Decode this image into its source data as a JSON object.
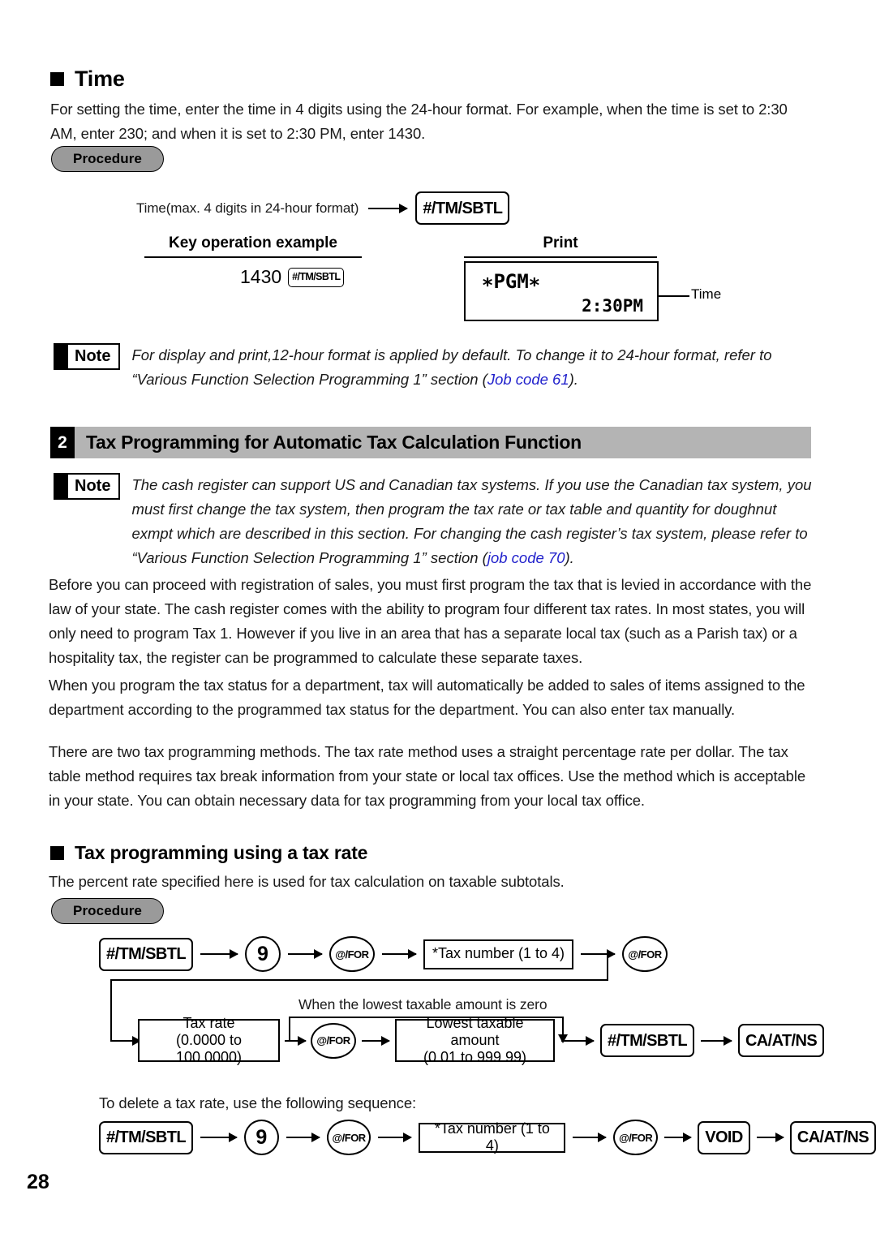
{
  "page": {
    "number": "28"
  },
  "time_section": {
    "heading": "Time",
    "intro": "For setting the time, enter the time in 4 digits using the 24-hour format.  For example, when the time is set to 2:30 AM, enter 230; and when it is set to 2:30 PM, enter 1430.",
    "procedure_label": "Procedure",
    "flow": {
      "input_label": "Time(max. 4 digits in 24-hour format)",
      "key": "#/TM/SBTL"
    },
    "table": {
      "col_key_operation": "Key operation example",
      "col_print": "Print",
      "key_example_digits": "1430",
      "key_example_key": "#/TM/SBTL",
      "receipt": {
        "header": "∗PGM∗",
        "time": "2:30PM"
      },
      "callout_time": "Time"
    },
    "note": {
      "label": "Note",
      "text_before": "For display and print,12-hour format is applied by default.  To change it to 24-hour format, refer to “Various Function Selection Programming 1” section (",
      "job_code": "Job code 61",
      "text_after": ")."
    }
  },
  "section2": {
    "number": "2",
    "title": "Tax Programming for Automatic Tax Calculation Function",
    "note": {
      "label": "Note",
      "text_before": "The cash register can support US and Canadian tax systems.  If you use the Canadian tax system, you must first change the tax system, then program the tax rate or tax table and quantity for doughnut exmpt which are described in this section.  For changing the cash register’s tax system, please refer to “Various Function Selection Programming 1” section (",
      "job_code": "job code 70",
      "text_after": ")."
    },
    "paragraphs": [
      "Before you can proceed with registration of sales, you must first program the tax that is levied in accordance with the law of your state.  The cash register comes with the ability to program four different tax rates.  In most states, you will only need to program Tax 1.  However if you live in an area that has a separate local tax (such as a Parish tax) or a hospitality tax, the register can be programmed to calculate these separate taxes.",
      "When you program the tax status for a department, tax will automatically be added to sales of items assigned to the department according to the programmed tax status for the department.  You can also enter tax manually.",
      "There are two tax programming methods.  The tax rate method uses a straight percentage rate per dollar.  The tax table method requires tax break information from your state or local tax offices.  Use the method which is acceptable in your state.  You can obtain necessary data for tax programming from your local tax office."
    ]
  },
  "tax_rate_section": {
    "heading": "Tax programming using a tax rate",
    "intro": "The percent rate specified here is used for tax calculation on taxable subtotals.",
    "procedure_label": "Procedure",
    "flow_row1": {
      "key_tmsbtl": "#/TM/SBTL",
      "key_nine": "9",
      "key_for_1": "@/FOR",
      "tax_number_box": "*Tax number (1 to 4)",
      "key_for_2": "@/FOR"
    },
    "flow_row2": {
      "bypass_label": "When the lowest taxable amount is zero",
      "tax_rate_line1": "Tax rate",
      "tax_rate_line2": "(0.0000 to 100.0000)",
      "key_for_3": "@/FOR",
      "lowest_line1": "Lowest taxable amount",
      "lowest_line2": "(0.01 to 999.99)",
      "key_tmsbtl_2": "#/TM/SBTL",
      "key_caatns": "CA/AT/NS"
    },
    "delete_intro": "To delete a tax rate, use the following sequence:",
    "flow_row3": {
      "key_tmsbtl": "#/TM/SBTL",
      "key_nine": "9",
      "key_for_1": "@/FOR",
      "tax_number_box": "*Tax number (1 to 4)",
      "key_for_2": "@/FOR",
      "key_void": "VOID",
      "key_caatns": "CA/AT/NS"
    }
  }
}
